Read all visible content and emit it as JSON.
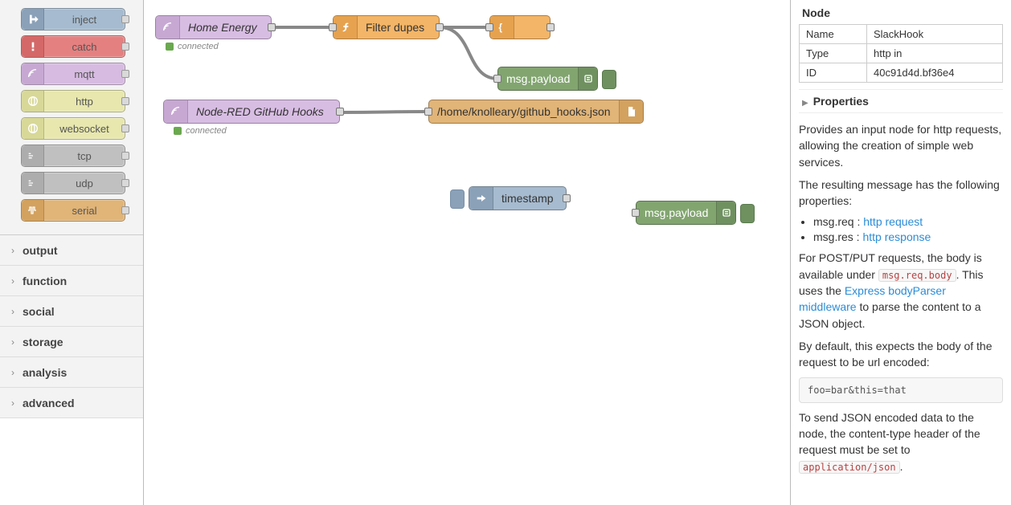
{
  "palette": {
    "nodes": [
      {
        "label": "inject",
        "port": "out"
      },
      {
        "label": "catch",
        "port": "out"
      },
      {
        "label": "mqtt",
        "port": "out"
      },
      {
        "label": "http",
        "port": "out"
      },
      {
        "label": "websocket",
        "port": "out"
      },
      {
        "label": "tcp",
        "port": "out"
      },
      {
        "label": "udp",
        "port": "out"
      },
      {
        "label": "serial",
        "port": "out"
      }
    ],
    "categories": [
      "output",
      "function",
      "social",
      "storage",
      "analysis",
      "advanced"
    ]
  },
  "flow": {
    "home_energy": {
      "label": "Home Energy",
      "status": "connected"
    },
    "filter_dupes": {
      "label": "Filter dupes"
    },
    "json_node": {
      "label": ""
    },
    "debug1": {
      "label": "msg.payload"
    },
    "github_hooks": {
      "label": "Node-RED GitHub Hooks",
      "status": "connected"
    },
    "file_node": {
      "label": "/home/knolleary/github_hooks.json"
    },
    "timestamp": {
      "label": "timestamp"
    },
    "debug2": {
      "label": "msg.payload"
    }
  },
  "sidebar": {
    "section": "Node",
    "rows": {
      "name_k": "Name",
      "name_v": "SlackHook",
      "type_k": "Type",
      "type_v": "http in",
      "id_k": "ID",
      "id_v": "40c91d4d.bf36e4"
    },
    "properties": "Properties",
    "p1": "Provides an input node for http requests, allowing the creation of simple web services.",
    "p2": "The resulting message has the following properties:",
    "li1a": "msg.req : ",
    "li1b": "http request",
    "li2a": "msg.res : ",
    "li2b": "http response",
    "p3a": "For POST/PUT requests, the body is available under ",
    "p3b": "msg.req.body",
    "p3c": ". This uses the ",
    "p3d": "Express bodyParser middleware",
    "p3e": " to parse the content to a JSON object.",
    "p4": "By default, this expects the body of the request to be url encoded:",
    "code1": "foo=bar&this=that",
    "p5a": "To send JSON encoded data to the node, the content-type header of the request must be set to ",
    "p5b": "application/json",
    "p5c": "."
  }
}
